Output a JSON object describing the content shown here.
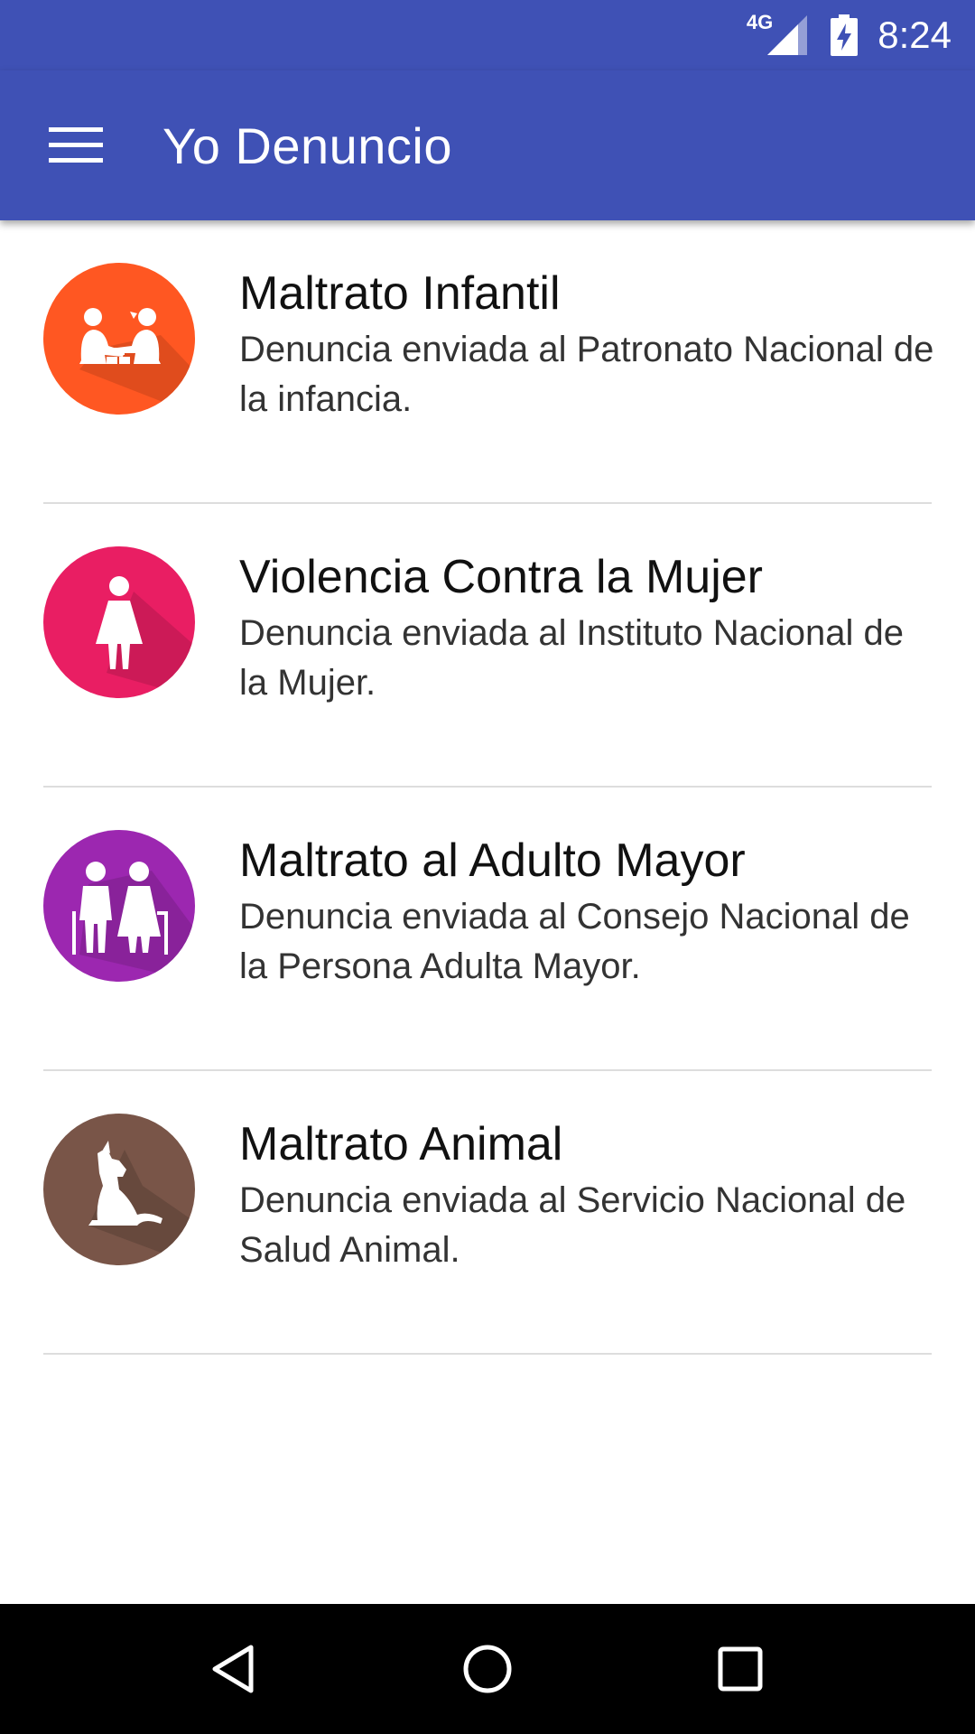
{
  "status_bar": {
    "network": "4G",
    "time": "8:24",
    "icons": [
      "signal-icon",
      "battery-charging-icon"
    ]
  },
  "app_bar": {
    "title": "Yo Denuncio",
    "menu_icon": "menu-icon",
    "color": "#3f51b5"
  },
  "reports": [
    {
      "title": "Maltrato Infantil",
      "description": "Denuncia enviada al Patronato Nacional de la infancia.",
      "icon": "children-playing-icon",
      "color": "#ff5722"
    },
    {
      "title": "Violencia Contra la Mujer",
      "description": "Denuncia enviada al Instituto Nacional de la Mujer.",
      "icon": "woman-icon",
      "color": "#e91e63"
    },
    {
      "title": "Maltrato al Adulto Mayor",
      "description": "Denuncia enviada al Consejo Nacional de la Persona Adulta Mayor.",
      "icon": "elderly-couple-icon",
      "color": "#9c27b0"
    },
    {
      "title": "Maltrato Animal",
      "description": "Denuncia enviada al Servicio Nacional de Salud Animal.",
      "icon": "dog-icon",
      "color": "#795548"
    }
  ],
  "nav_bar": {
    "icons": [
      "back-icon",
      "home-icon",
      "recents-icon"
    ]
  }
}
